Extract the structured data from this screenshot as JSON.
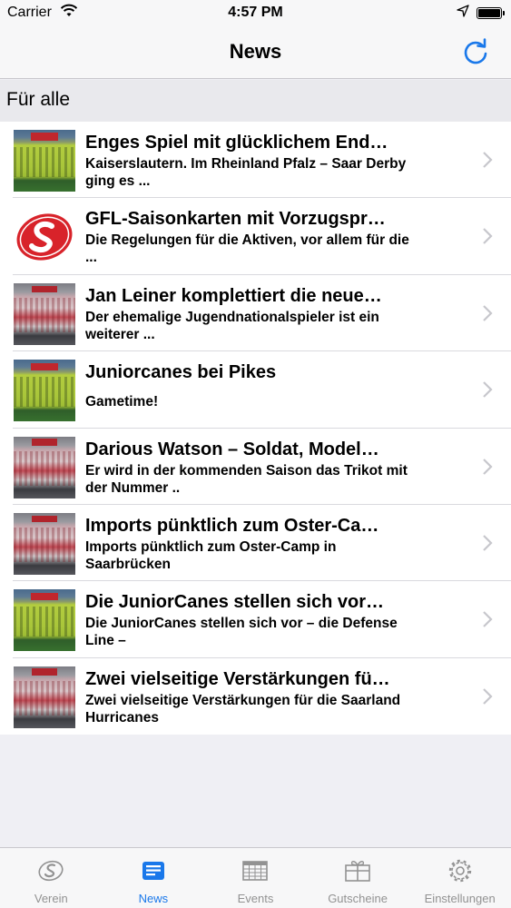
{
  "status_bar": {
    "carrier": "Carrier",
    "time": "4:57 PM"
  },
  "nav": {
    "title": "News",
    "refresh_icon": "refresh-icon"
  },
  "section": {
    "header": "Für alle"
  },
  "news": [
    {
      "title": "Enges Spiel mit glücklichem End…",
      "subtitle": "Kaiserslautern. Im Rheinland Pfalz – Saar Derby ging es ...",
      "thumb": "team-photo-green"
    },
    {
      "title": " GFL-Saisonkarten mit Vorzugspr…",
      "subtitle": "Die Regelungen für die Aktiven, vor allem für die ...",
      "thumb": "gfl-logo"
    },
    {
      "title": " Jan Leiner komplettiert die neue…",
      "subtitle": "Der ehemalige Jugendnationalspieler ist ein weiterer ...",
      "thumb": "team-photo-red"
    },
    {
      "title": "Juniorcanes bei Pikes",
      "subtitle": "Gametime!",
      "thumb": "team-photo-green"
    },
    {
      "title": "Darious Watson – Soldat, Model…",
      "subtitle": "Er wird in der kommenden Saison das Trikot mit der Nummer ..",
      "thumb": "team-photo-red"
    },
    {
      "title": "Imports pünktlich zum Oster-Ca…",
      "subtitle": "Imports pünktlich zum Oster-Camp in Saarbrücken",
      "thumb": "team-photo-red"
    },
    {
      "title": "Die JuniorCanes stellen sich vor…",
      "subtitle": "Die JuniorCanes stellen sich vor – die Defense Line –",
      "thumb": "team-photo-green"
    },
    {
      "title": "Zwei vielseitige Verstärkungen fü…",
      "subtitle": "Zwei vielseitige Verstärkungen für die Saarland Hurricanes",
      "thumb": "team-photo-red"
    }
  ],
  "tabs": [
    {
      "label": "Verein",
      "icon": "club-logo-icon",
      "active": false
    },
    {
      "label": "News",
      "icon": "newspaper-icon",
      "active": true
    },
    {
      "label": "Events",
      "icon": "calendar-icon",
      "active": false
    },
    {
      "label": "Gutscheine",
      "icon": "gift-icon",
      "active": false
    },
    {
      "label": "Einstellungen",
      "icon": "gear-icon",
      "active": false
    }
  ],
  "colors": {
    "accent": "#1a78ea",
    "inactive": "#929292",
    "background": "#efeff4"
  }
}
